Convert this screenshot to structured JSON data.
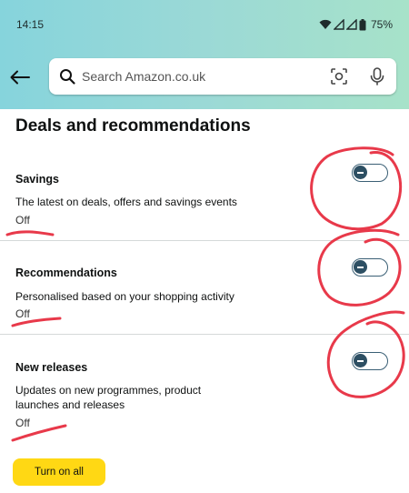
{
  "status_bar": {
    "time": "14:15",
    "battery": "75%",
    "icons": [
      "wifi-icon",
      "signal-icon",
      "signal-icon",
      "battery-icon"
    ]
  },
  "header": {
    "gradient": [
      "#86d4dc",
      "#a7e2c9"
    ],
    "back_icon": "arrow-left-icon",
    "search": {
      "placeholder": "Search Amazon.co.uk",
      "value": "",
      "icons": [
        "search-icon",
        "camera-scan-icon",
        "microphone-icon"
      ]
    }
  },
  "page": {
    "title": "Deals and recommendations"
  },
  "sections": [
    {
      "title": "Savings",
      "description": "The latest on deals, offers and savings events",
      "status": "Off",
      "toggle_on": false
    },
    {
      "title": "Recommendations",
      "description": "Personalised based on your shopping activity",
      "status": "Off",
      "toggle_on": false
    },
    {
      "title": "New releases",
      "description": "Updates on new programmes, product launches and releases",
      "status": "Off",
      "toggle_on": false
    }
  ],
  "actions": {
    "turn_on_all": "Turn on all"
  },
  "colors": {
    "accent_button": "#ffd814",
    "toggle": "#2d4f63",
    "annotation": "#e8394a"
  }
}
